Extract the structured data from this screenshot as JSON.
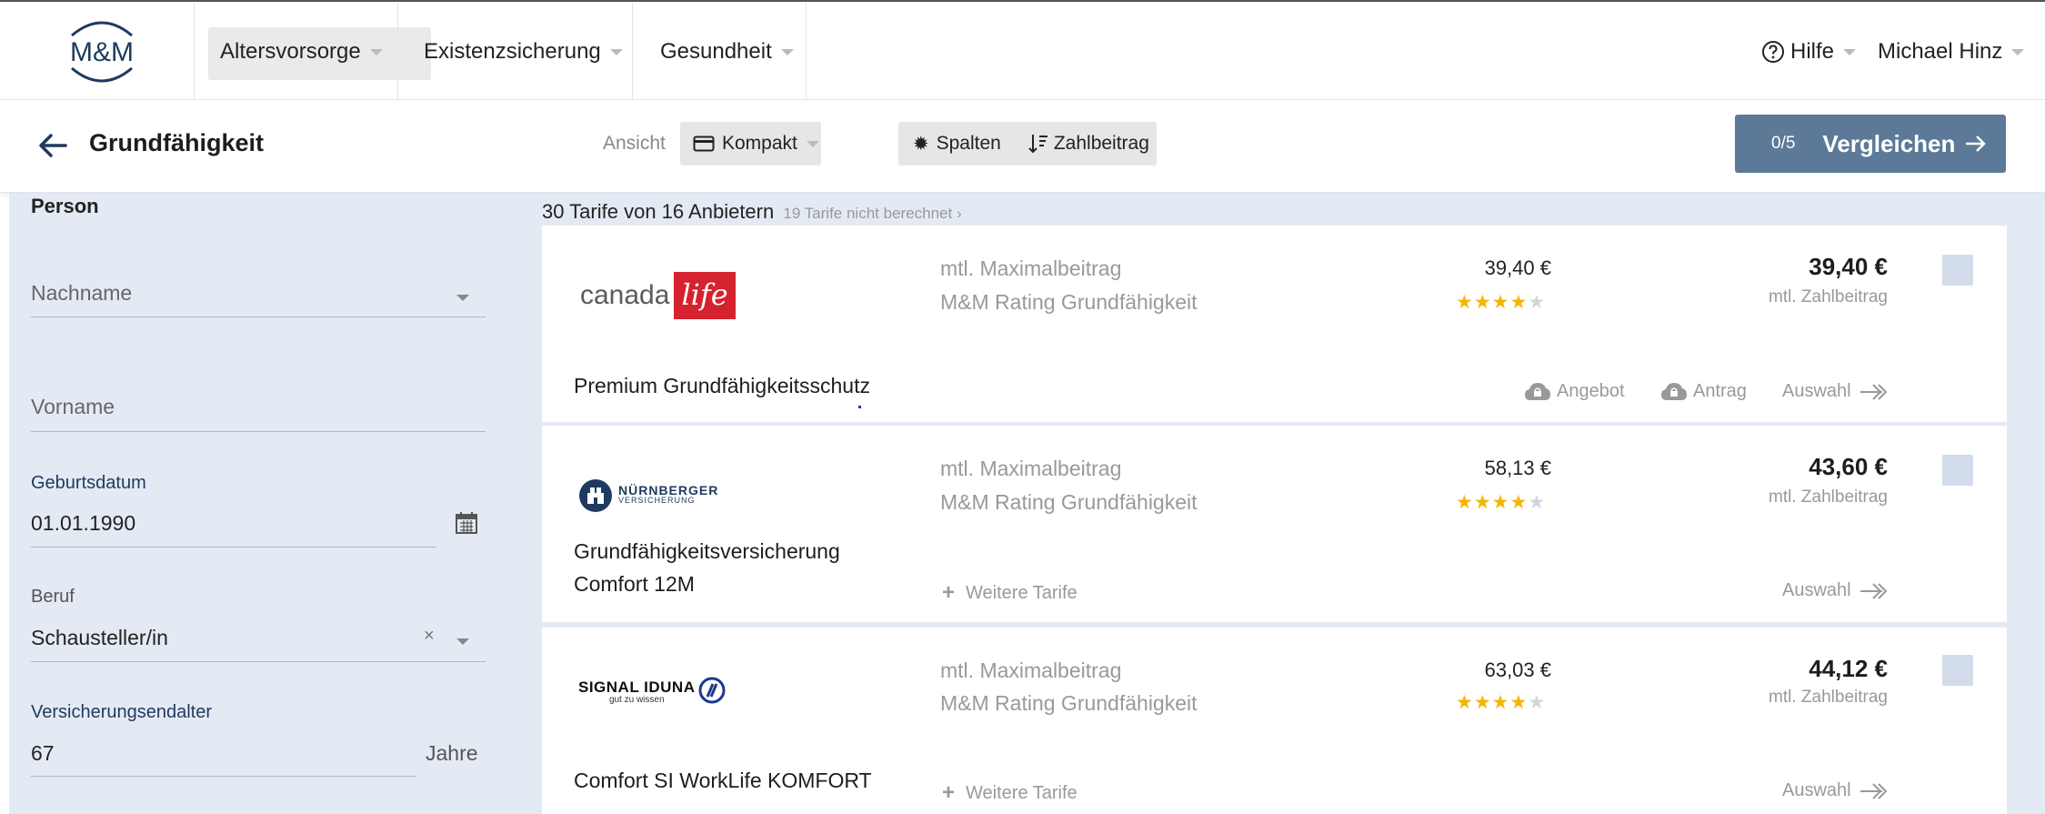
{
  "header": {
    "logo_text": "M&M",
    "nav": [
      {
        "label": "Altersvorsorge"
      },
      {
        "label": "Existenzsicherung"
      },
      {
        "label": "Gesundheit"
      }
    ],
    "help_label": "Hilfe",
    "user_name": "Michael Hinz"
  },
  "toolbar": {
    "title": "Grundfähigkeit",
    "view_label": "Ansicht",
    "view_value": "Kompakt",
    "columns_label": "Spalten",
    "sort_label": "Zahlbeitrag",
    "compare_count": "0/5",
    "compare_label": "Vergleichen"
  },
  "sidebar": {
    "heading": "Person",
    "lastname_placeholder": "Nachname",
    "firstname_placeholder": "Vorname",
    "birthdate_label": "Geburtsdatum",
    "birthdate_value": "01.01.1990",
    "job_label": "Beruf",
    "job_value": "Schausteller/in",
    "end_age_label": "Versicherungsendalter",
    "end_age_value": "67",
    "end_age_unit": "Jahre"
  },
  "results": {
    "count_text": "30 Tarife von 16 Anbietern",
    "not_calculated": "19 Tarife nicht berechnet",
    "labels": {
      "max": "mtl. Maximalbeitrag",
      "rating": "M&M Rating Grundfähigkeit",
      "payment": "mtl. Zahlbeitrag",
      "offer": "Angebot",
      "application": "Antrag",
      "select": "Auswahl",
      "more": "Weitere Tarife"
    },
    "cards": [
      {
        "provider": "canada life",
        "logo_left": "canada",
        "logo_right": "life",
        "tariff": [
          "Premium Grundfähigkeitsschutz"
        ],
        "max_value": "39,40 €",
        "rating": 4,
        "price": "39,40 €"
      },
      {
        "provider": "NÜRNBERGER VERSICHERUNG",
        "logo_main": "NÜRNBERGER",
        "logo_sub": "VERSICHERUNG",
        "tariff": [
          "Grundfähigkeitsversicherung",
          "Comfort 12M"
        ],
        "max_value": "58,13 €",
        "rating": 4,
        "price": "43,60 €"
      },
      {
        "provider": "SIGNAL IDUNA",
        "logo_main": "SIGNAL IDUNA",
        "logo_sub": "gut zu wissen",
        "tariff": [
          "Comfort SI WorkLife KOMFORT"
        ],
        "max_value": "63,03 €",
        "rating": 4,
        "price": "44,12 €"
      }
    ]
  },
  "colors": {
    "brand_navy": "#1e3a5e",
    "compare_button": "#5c7a98",
    "sidebar_bg": "#e4eaf3",
    "star": "#f5b500",
    "canada_red": "#d5222f"
  }
}
